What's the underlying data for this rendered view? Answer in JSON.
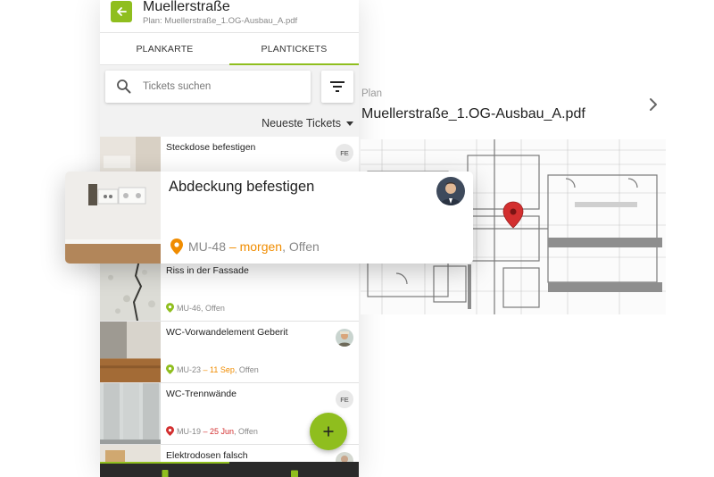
{
  "header": {
    "title": "Muellerstraße",
    "subtitle": "Plan: Muellerstraße_1.OG-Ausbau_A.pdf",
    "back_icon": "arrow-left-icon"
  },
  "tabs": [
    {
      "label": "PLANKARTE",
      "active": false
    },
    {
      "label": "PLANTICKETS",
      "active": true
    }
  ],
  "search": {
    "placeholder": "Tickets suchen",
    "value": ""
  },
  "sort": {
    "label": "Neueste Tickets"
  },
  "tickets": [
    {
      "title": "Steckdose befestigen",
      "assignee": "FE"
    },
    {
      "title": "Riss in der Fassade",
      "id": "MU-46",
      "status": ", Offen",
      "pin_color": "#8fbe1e"
    },
    {
      "title": "WC-Vorwandelement Geberit",
      "id": "MU-23",
      "due": " – 11 Sep",
      "status": ", Offen",
      "pin_color": "#8fbe1e"
    },
    {
      "title": "WC-Trennwände",
      "id": "MU-19",
      "due": " – 25 Jun",
      "status": ", Offen",
      "assignee": "FE",
      "pin_color": "#d32f2f"
    },
    {
      "title": "Elektrodosen falsch"
    }
  ],
  "card": {
    "title": "Abdeckung befestigen",
    "id": "MU-48",
    "due": " – morgen",
    "status": ", Offen",
    "pin_color": "#f08c00"
  },
  "plan": {
    "label": "Plan",
    "name": "Muellerstraße_1.OG-Ausbau_A.pdf"
  },
  "colors": {
    "accent": "#8fbe1e",
    "due_orange": "#f08c00",
    "due_red": "#d32f2f",
    "plan_marker": "#d32f2f"
  }
}
